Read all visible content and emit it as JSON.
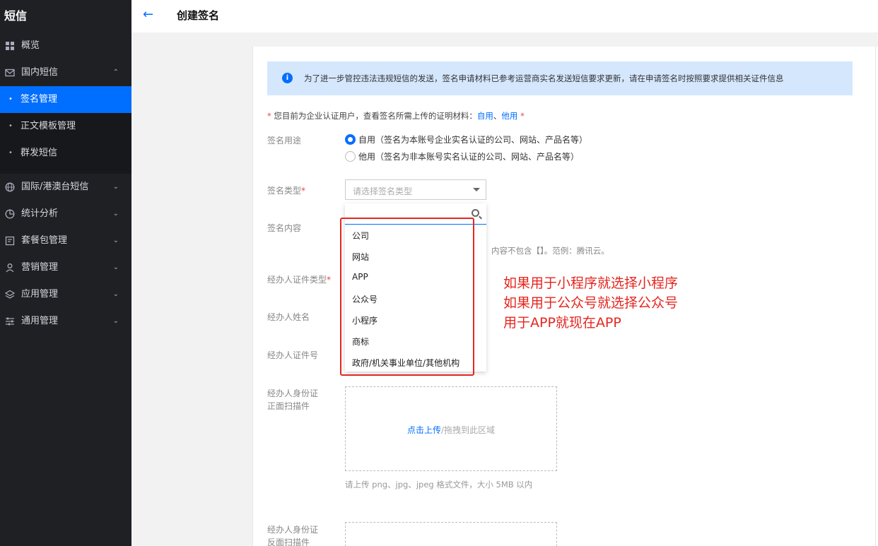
{
  "sidebar": {
    "brand": "短信",
    "overview": "概览",
    "domestic": "国内短信",
    "sub_items": [
      "签名管理",
      "正文模板管理",
      "群发短信"
    ],
    "intl": "国际/港澳台短信",
    "stats": "统计分析",
    "packages": "套餐包管理",
    "marketing": "营销管理",
    "apps": "应用管理",
    "general": "通用管理"
  },
  "header": {
    "title": "创建签名"
  },
  "notice": "为了进一步管控违法违规短信的发送，签名申请材料已参考运营商实名发送短信要求更新，请在申请签名时按照要求提供相关证件信息",
  "tip": {
    "prefix": "您目前为企业认证用户，查看签名所需上传的证明材料：",
    "link_self": "自用",
    "sep": "、",
    "link_other": "他用"
  },
  "form": {
    "usage_label": "签名用途",
    "usage_self": "自用（签名为本账号企业实名认证的公司、网站、产品名等）",
    "usage_other": "他用（签名为非本账号实名认证的公司、网站、产品名等）",
    "type_label": "签名类型",
    "type_placeholder": "请选择签名类型",
    "content_label": "签名内容",
    "content_hint": "内容不包含【】。范例：腾讯云。",
    "id_type_label": "经办人证件类型",
    "name_label": "经办人姓名",
    "id_no_label": "经办人证件号",
    "front_label_1": "经办人身份证",
    "front_label_2": "正面扫描件",
    "back_label_1": "经办人身份证",
    "back_label_2": "反面扫描件",
    "upload_link": "点击上传",
    "upload_rest": "/拖拽到此区域",
    "upload_hint": "请上传 png、jpg、jpeg 格式文件，大小 5MB 以内"
  },
  "dropdown_options": [
    "公司",
    "网站",
    "APP",
    "公众号",
    "小程序",
    "商标",
    "政府/机关事业单位/其他机构"
  ],
  "annotation": [
    "如果用于小程序就选择小程序",
    "如果用于公众号就选择公众号",
    "用于APP就现在APP"
  ],
  "colors": {
    "accent": "#006eff",
    "annotation_red": "#e5261f",
    "sidebar_bg": "#1f2024"
  }
}
